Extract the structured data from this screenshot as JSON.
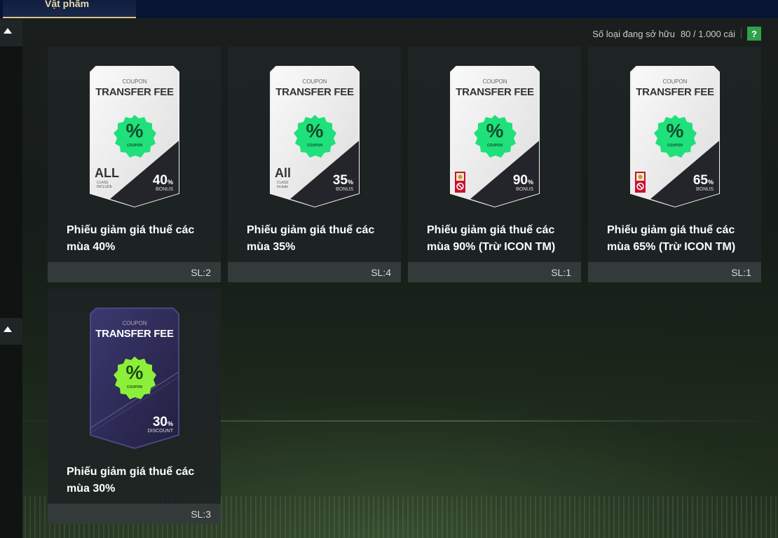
{
  "tab": {
    "label": "Vật phẩm"
  },
  "ownership": {
    "label": "Số loại đang sở hữu",
    "value": "80 / 1.000 cái",
    "help": "?"
  },
  "items": [
    {
      "name": "Phiếu giảm giá thuế các mùa 40%",
      "qty": "SL:2",
      "coupon": {
        "small": "COUPON",
        "title": "TRANSFER FEE",
        "badge": "%",
        "badge_sub": "COUPON",
        "class_text": "ALL",
        "class_sub": "CLASS INCLUDE",
        "value": "40",
        "unit": "%",
        "value_sub": "BONUS"
      }
    },
    {
      "name": "Phiếu giảm giá thuế các mùa 35%",
      "qty": "SL:4",
      "coupon": {
        "small": "COUPON",
        "title": "TRANSFER FEE",
        "badge": "%",
        "badge_sub": "COUPON",
        "class_text": "All",
        "class_sub": "CLASS Include",
        "value": "35",
        "unit": "%",
        "value_sub": "BONUS"
      }
    },
    {
      "name": "Phiếu giảm giá thuế các mùa 90% (Trừ ICON TM)",
      "qty": "SL:1",
      "coupon": {
        "small": "COUPON",
        "title": "TRANSFER FEE",
        "badge": "%",
        "badge_sub": "COUPON",
        "value": "90",
        "unit": "%",
        "value_sub": "BONUS"
      }
    },
    {
      "name": "Phiếu giảm giá thuế các mùa 65% (Trừ ICON TM)",
      "qty": "SL:1",
      "coupon": {
        "small": "COUPON",
        "title": "TRANSFER FEE",
        "badge": "%",
        "badge_sub": "COUPON",
        "value": "65",
        "unit": "%",
        "value_sub": "BONUS"
      }
    },
    {
      "name": "Phiếu giảm giá thuế các mùa 30%",
      "qty": "SL:3",
      "coupon": {
        "small": "COUPON",
        "title": "TRANSFER FEE",
        "badge": "%",
        "badge_sub": "COUPON",
        "value": "30",
        "unit": "%",
        "value_sub": "DISCOUNT"
      }
    }
  ],
  "colors": {
    "tab_accent": "#d8c48a",
    "help_green": "#2fa14a",
    "badge_green": "#1fe07a",
    "badge_lime": "#8cf03a",
    "dark_coupon": "#2d2a55"
  }
}
